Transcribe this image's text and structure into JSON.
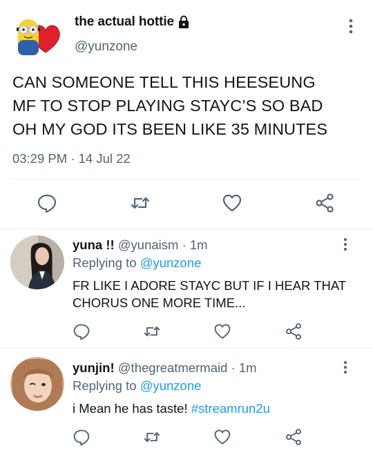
{
  "main_tweet": {
    "display_name": "the actual hottie",
    "handle": "@yunzone",
    "text": "CAN SOMEONE TELL THIS HEESEUNG\nMF TO STOP PLAYING STAYC’S SO BAD\nOH MY GOD ITS BEEN LIKE 35 MINUTES",
    "timestamp": "03:29 PM · 14 Jul 22"
  },
  "replies": [
    {
      "display_name": "yuna !!",
      "handle": "@yunaism",
      "time": "· 1m",
      "replying_prefix": "Replying to ",
      "replying_to": "@yunzone",
      "text": "FR LIKE I ADORE STAYC BUT IF I HEAR THAT CHORUS ONE MORE TIME..."
    },
    {
      "display_name": "yunjin!",
      "handle": "@thegreatmermaid",
      "time": "· 1m",
      "replying_prefix": "Replying to ",
      "replying_to": "@yunzone",
      "text": "i Mean he has taste! ",
      "hashtag": "#streamrun2u"
    }
  ],
  "icons": {
    "actions": [
      "reply-icon",
      "retweet-icon",
      "like-icon",
      "share-icon"
    ],
    "more": "more-vertical-icon",
    "lock": "lock-icon"
  },
  "colors": {
    "text": "#0f1419",
    "secondary": "#536471",
    "accent": "#1d9bf0",
    "divider": "#e6ecf0"
  }
}
